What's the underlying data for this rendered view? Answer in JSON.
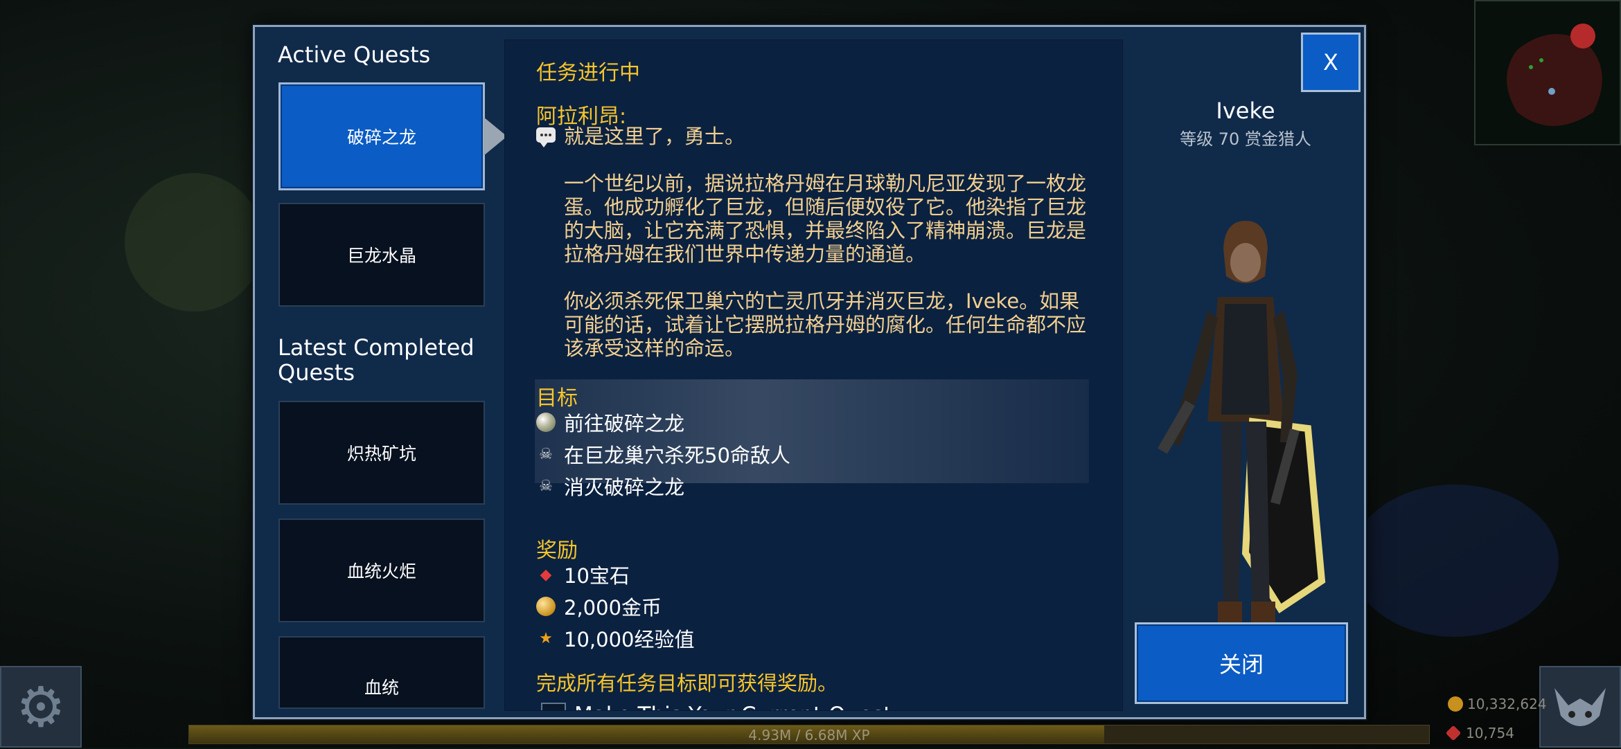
{
  "left": {
    "active_title": "Active Quests",
    "active_quests": [
      "破碎之龙"
    ],
    "other_quests": [
      "巨龙水晶"
    ],
    "completed_title": "Latest Completed\nQuests",
    "completed_quests": [
      "炽热矿坑",
      "血统火炬",
      "血统"
    ]
  },
  "quest": {
    "status": "任务进行中",
    "speaker": "阿拉利昂:",
    "dialogue": "就是这里了，勇士。\n\n一个世纪以前，据说拉格丹姆在月球勒凡尼亚发现了一枚龙\n蛋。他成功孵化了巨龙，但随后便奴役了它。他染指了巨龙\n的大脑，让它充满了恐惧，并最终陷入了精神崩溃。巨龙是\n拉格丹姆在我们世界中传递力量的通道。\n\n你必须杀死保卫巢穴的亡灵爪牙并消灭巨龙，Iveke。如果\n可能的话，试着让它摆脱拉格丹姆的腐化。任何生命都不应\n该承受这样的命运。",
    "objectives_title": "目标",
    "objectives": [
      {
        "icon": "globe-icon",
        "text": "前往破碎之龙"
      },
      {
        "icon": "skull-icon",
        "text": "在巨龙巢穴杀死50命敌人"
      },
      {
        "icon": "skull-icon",
        "text": "消灭破碎之龙"
      }
    ],
    "rewards_title": "奖励",
    "rewards": [
      {
        "icon": "gem-icon",
        "text": "10宝石"
      },
      {
        "icon": "coin-icon",
        "text": "2,000金币"
      },
      {
        "icon": "xp-star-icon",
        "text": "10,000经验值"
      }
    ],
    "reward_note": "完成所有任务目标即可获得奖励。",
    "make_current_label": "Make This Your Current Quest",
    "make_current_checked": false
  },
  "character": {
    "name": "Iveke",
    "subtitle": "等级 70 赏金猎人"
  },
  "buttons": {
    "x_label": "X",
    "close_label": "关闭"
  },
  "hud": {
    "xp_text": "4.93M / 6.68M XP",
    "xp_fraction": 0.738,
    "gold": "10,332,624",
    "gems": "10,754"
  }
}
